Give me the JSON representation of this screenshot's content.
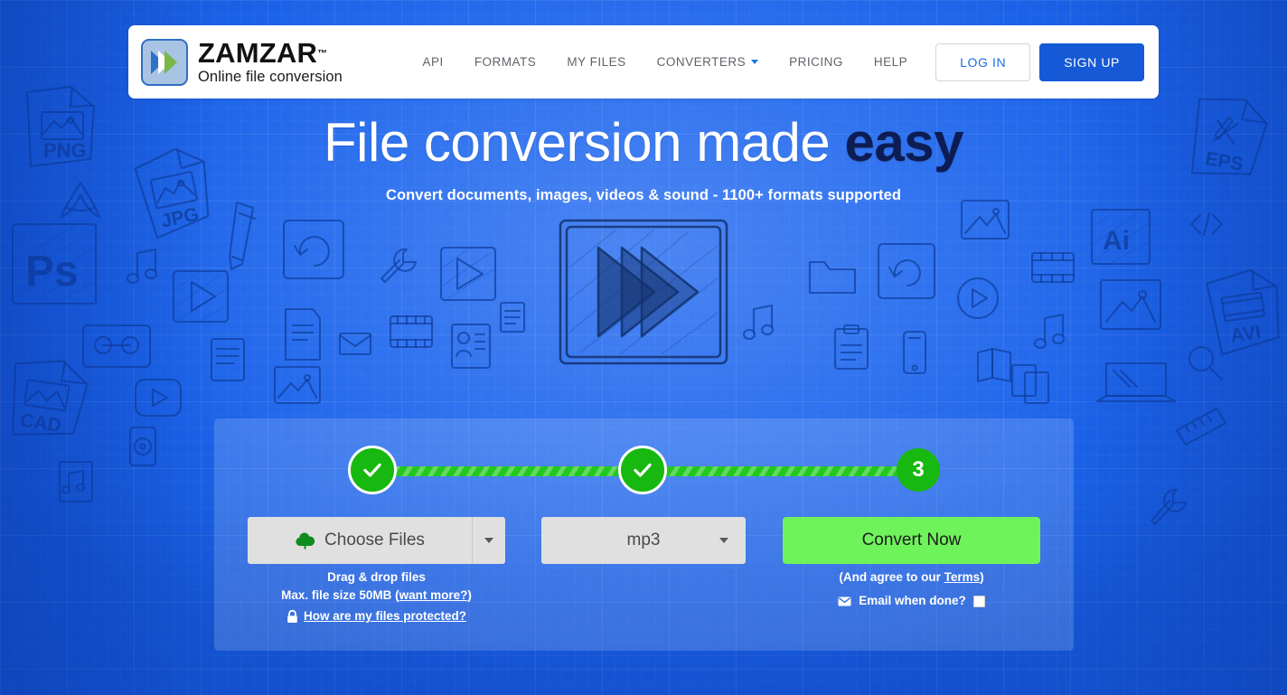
{
  "header": {
    "brand_name": "ZAMZAR",
    "brand_tm": "™",
    "brand_tagline": "Online file conversion",
    "logo_icon": "double-chevron-logo-icon",
    "nav": [
      {
        "label": "API",
        "name": "nav-item-api"
      },
      {
        "label": "FORMATS",
        "name": "nav-item-formats"
      },
      {
        "label": "MY FILES",
        "name": "nav-item-my-files"
      },
      {
        "label": "CONVERTERS",
        "name": "nav-item-converters",
        "has_caret": true
      },
      {
        "label": "PRICING",
        "name": "nav-item-pricing"
      },
      {
        "label": "HELP",
        "name": "nav-item-help"
      }
    ],
    "login_label": "LOG IN",
    "signup_label": "SIGN UP"
  },
  "hero": {
    "title_plain": "File conversion made ",
    "title_accent": "easy",
    "subtitle": "Convert documents, images, videos & sound - 1100+ formats supported",
    "art_icon": "fast-forward-sketch-icon"
  },
  "steps": {
    "step1_state": "complete",
    "step1_icon": "check-icon",
    "step2_state": "complete",
    "step2_icon": "check-icon",
    "step3_label": "3"
  },
  "controls": {
    "choose_files_label": "Choose Files",
    "choose_files_icon": "cloud-upload-icon",
    "choose_files_caret_icon": "chevron-down-icon",
    "format_value": "mp3",
    "format_caret_icon": "chevron-down-icon",
    "convert_label": "Convert Now"
  },
  "help": {
    "drag_drop": "Drag & drop files",
    "max_size_prefix": "Max. file size 50MB (",
    "max_size_link": "want more?",
    "max_size_suffix": ")",
    "lock_icon": "padlock-icon",
    "protected_link": "How are my files protected?",
    "terms_prefix": "(And agree to our ",
    "terms_link": "Terms",
    "terms_suffix": ")",
    "email_icon": "envelope-icon",
    "email_label": "Email when done?",
    "email_checked": false
  },
  "doodles": {
    "labels": [
      "PNG",
      "JPG",
      "PS",
      "CAD",
      "EPS",
      "Ai",
      "AVI"
    ]
  },
  "colors": {
    "page_blue": "#1b62e8",
    "brand_blue": "#1559d6",
    "link_blue": "#1a73e8",
    "green_step": "#17b80f",
    "green_bar": "#22c81e",
    "green_convert": "#6ff35a",
    "accent_navy": "#0d1c52",
    "card_overlay": "rgba(255,255,255,0.155)"
  }
}
